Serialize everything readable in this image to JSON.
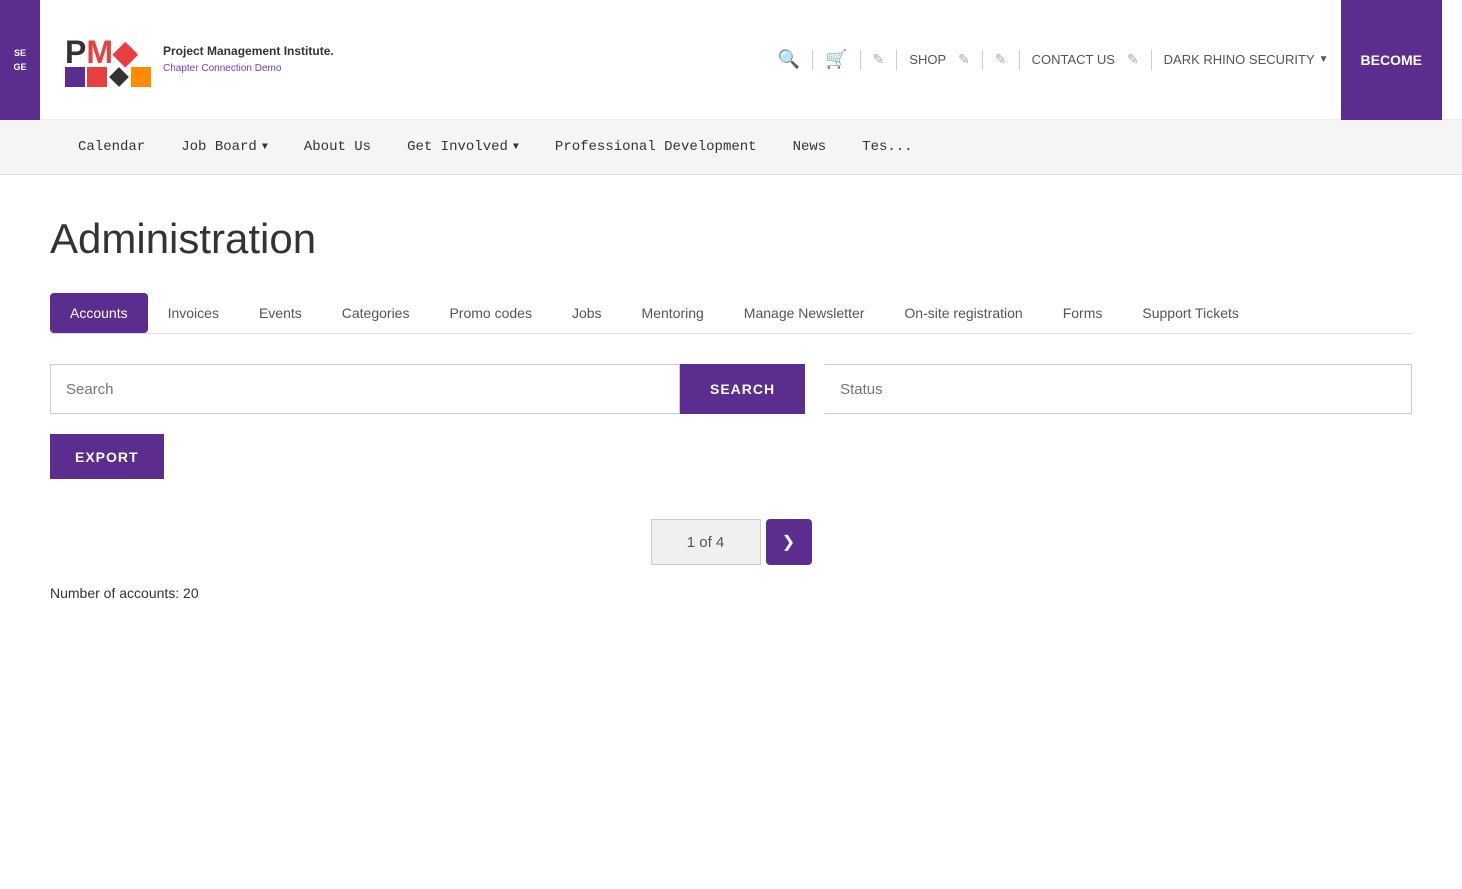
{
  "topbar": {
    "logo": {
      "letters": "PMI",
      "org_name": "Project Management Institute.",
      "subtitle": "Chapter Connection Demo"
    },
    "left_partial": {
      "line1": "SE",
      "line2": "GE"
    },
    "nav_links": {
      "shop": "SHOP",
      "contact_us": "CONTACT US",
      "dark_rhino": "DARK RHINO SECURITY",
      "become": "BECOME"
    }
  },
  "nav": {
    "items": [
      {
        "label": "Calendar",
        "has_dropdown": false
      },
      {
        "label": "Job Board",
        "has_dropdown": true
      },
      {
        "label": "About Us",
        "has_dropdown": false
      },
      {
        "label": "Get Involved",
        "has_dropdown": true
      },
      {
        "label": "Professional Development",
        "has_dropdown": false
      },
      {
        "label": "News",
        "has_dropdown": false
      },
      {
        "label": "Tes...",
        "has_dropdown": false
      }
    ]
  },
  "page": {
    "title": "Administration"
  },
  "admin_tabs": {
    "items": [
      {
        "label": "Accounts",
        "active": true
      },
      {
        "label": "Invoices",
        "active": false
      },
      {
        "label": "Events",
        "active": false
      },
      {
        "label": "Categories",
        "active": false
      },
      {
        "label": "Promo codes",
        "active": false
      },
      {
        "label": "Jobs",
        "active": false
      },
      {
        "label": "Mentoring",
        "active": false
      },
      {
        "label": "Manage Newsletter",
        "active": false
      },
      {
        "label": "On-site registration",
        "active": false
      },
      {
        "label": "Forms",
        "active": false
      },
      {
        "label": "Support Tickets",
        "active": false
      }
    ]
  },
  "search": {
    "placeholder": "Search",
    "button_label": "SEARCH",
    "status_placeholder": "Status"
  },
  "export": {
    "button_label": "EXPORT"
  },
  "pagination": {
    "current": "1 of 4",
    "next_icon": "❯"
  },
  "footer": {
    "account_count_label": "Number of accounts: 20"
  }
}
